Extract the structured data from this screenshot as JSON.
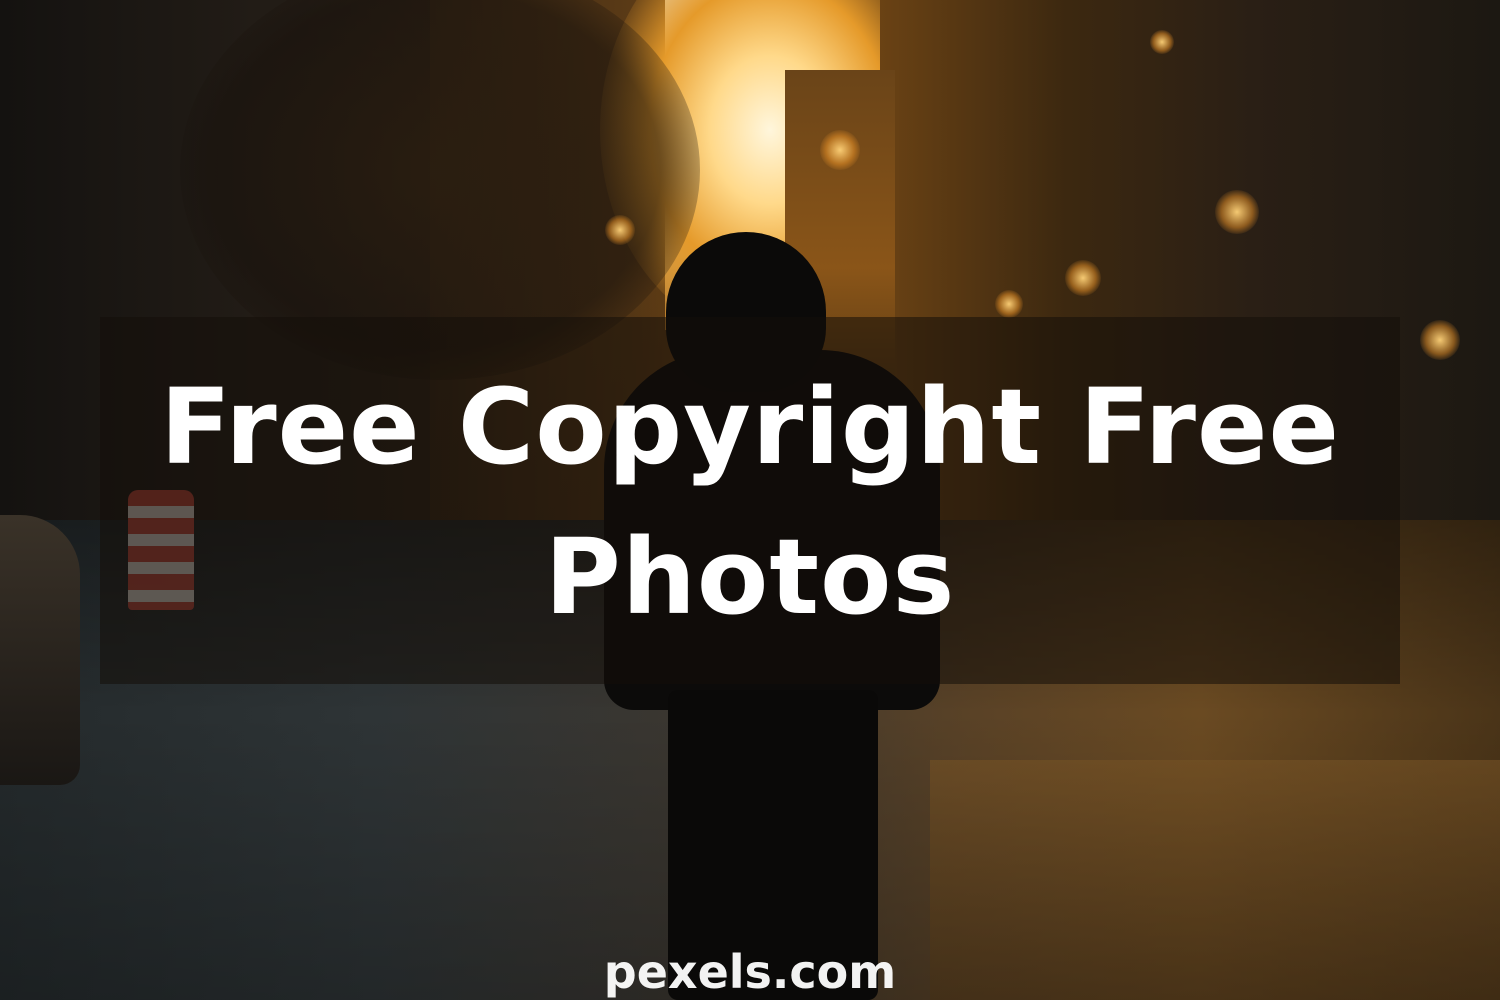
{
  "hero": {
    "title": "Free Copyright Free Photos"
  },
  "watermark": {
    "text": "pexels.com"
  },
  "colors": {
    "title_text": "#ffffff",
    "overlay_band": "rgba(20, 14, 10, 0.55)",
    "sunlight": "#ffd98a"
  }
}
